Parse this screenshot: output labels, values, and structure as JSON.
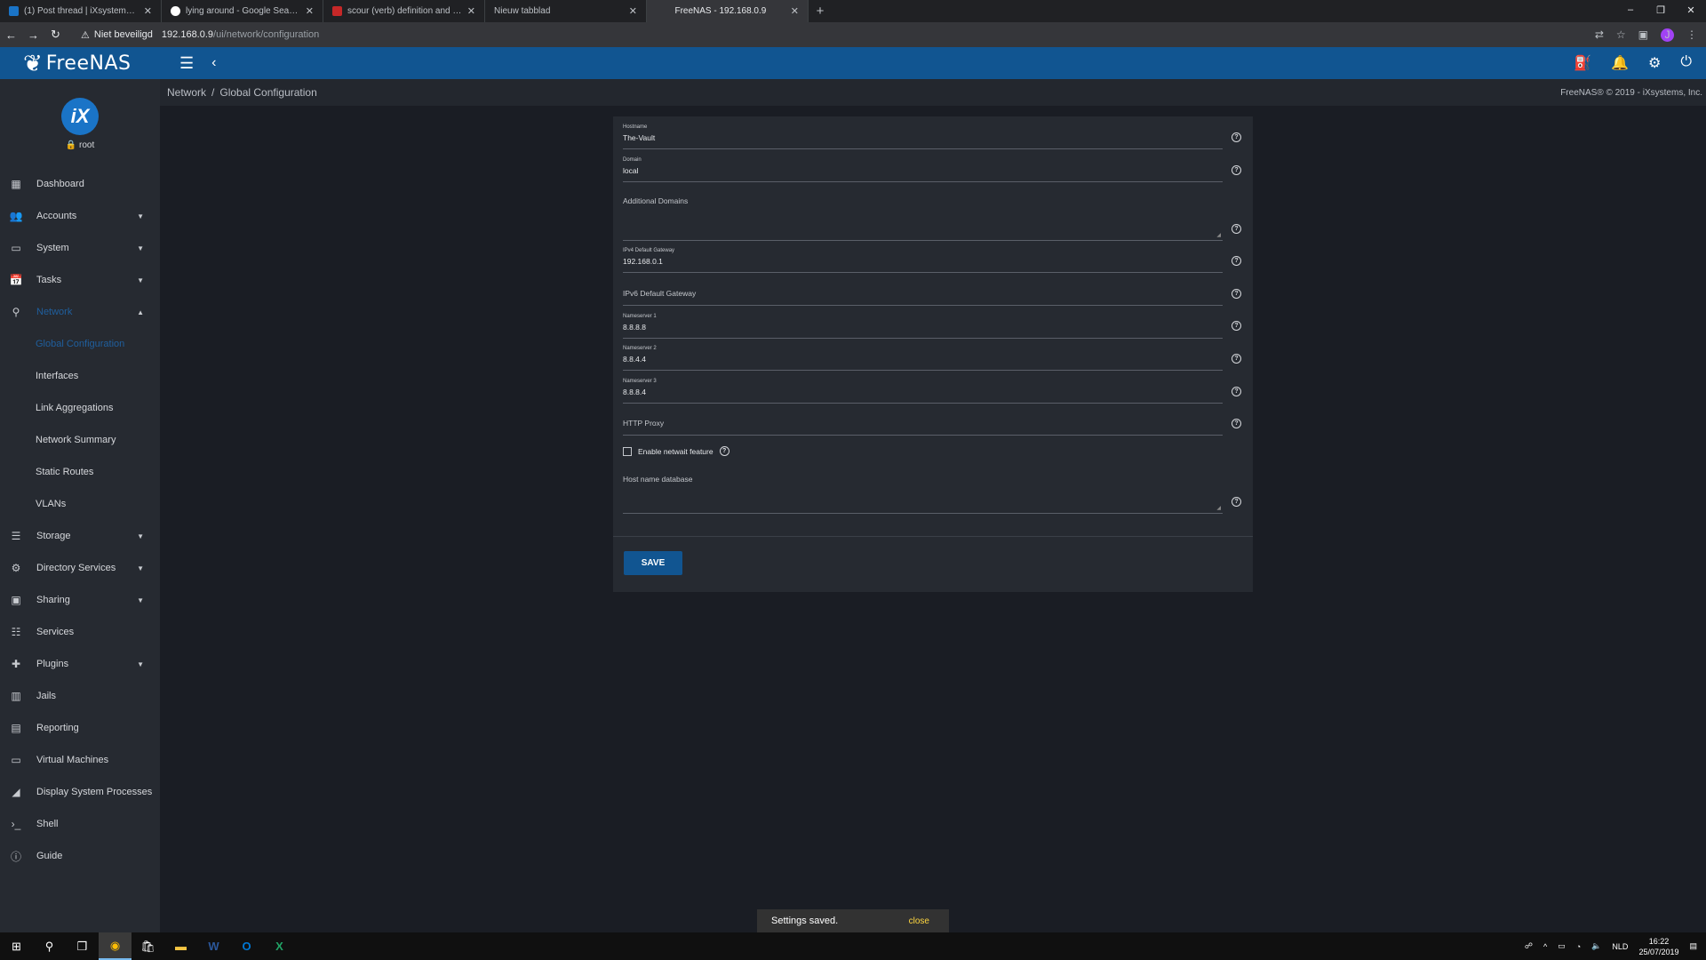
{
  "browser": {
    "tabs": [
      {
        "title": "(1) Post thread | iXsystems Comm",
        "color": "#1a74c7",
        "active": false
      },
      {
        "title": "lying around - Google Search",
        "color": "#ffffff",
        "active": false
      },
      {
        "title": "scour (verb) definition and synonyms",
        "color": "#c62828",
        "active": false
      },
      {
        "title": "Nieuw tabblad",
        "color": "",
        "active": false
      },
      {
        "title": "FreeNAS - 192.168.0.9",
        "color": "",
        "active": true
      }
    ],
    "not_secure_label": "Niet beveiligd",
    "url_host": "192.168.0.9",
    "url_path": "/ui/network/configuration"
  },
  "app": {
    "logo_text": "FreeNAS",
    "breadcrumb": [
      "Network",
      "Global Configuration"
    ],
    "copyright": "FreeNAS® © 2019 - iXsystems, Inc."
  },
  "sidebar": {
    "logo_text": "iX",
    "user": "root",
    "items": [
      {
        "label": "Dashboard",
        "icon": "▦",
        "caret": false
      },
      {
        "label": "Accounts",
        "icon": "👥",
        "caret": true
      },
      {
        "label": "System",
        "icon": "▭",
        "caret": true
      },
      {
        "label": "Tasks",
        "icon": "📅",
        "caret": true
      },
      {
        "label": "Network",
        "icon": "⚲",
        "caret": true,
        "active": true
      }
    ],
    "network_sub": [
      {
        "label": "Global Configuration",
        "active": true
      },
      {
        "label": "Interfaces"
      },
      {
        "label": "Link Aggregations"
      },
      {
        "label": "Network Summary"
      },
      {
        "label": "Static Routes"
      },
      {
        "label": "VLANs"
      }
    ],
    "items_after": [
      {
        "label": "Storage",
        "icon": "☰",
        "caret": true
      },
      {
        "label": "Directory Services",
        "icon": "⚙",
        "caret": true
      },
      {
        "label": "Sharing",
        "icon": "▣",
        "caret": true
      },
      {
        "label": "Services",
        "icon": "☷",
        "caret": false
      },
      {
        "label": "Plugins",
        "icon": "✚",
        "caret": true
      },
      {
        "label": "Jails",
        "icon": "▥",
        "caret": false
      },
      {
        "label": "Reporting",
        "icon": "▤",
        "caret": false
      },
      {
        "label": "Virtual Machines",
        "icon": "▭",
        "caret": false
      },
      {
        "label": "Display System Processes",
        "icon": "◢",
        "caret": false
      },
      {
        "label": "Shell",
        "icon": "›_",
        "caret": false
      },
      {
        "label": "Guide",
        "icon": "ⓘ",
        "caret": false
      }
    ]
  },
  "form": {
    "hostname": {
      "label": "Hostname",
      "value": "The-Vault"
    },
    "domain": {
      "label": "Domain",
      "value": "local"
    },
    "additional_domains": {
      "placeholder": "Additional Domains"
    },
    "ipv4_gateway": {
      "label": "IPv4 Default Gateway",
      "value": "192.168.0.1"
    },
    "ipv6_gateway": {
      "placeholder": "IPv6 Default Gateway"
    },
    "nameserver1": {
      "label": "Nameserver 1",
      "value": "8.8.8.8"
    },
    "nameserver2": {
      "label": "Nameserver 2",
      "value": "8.8.4.4"
    },
    "nameserver3": {
      "label": "Nameserver 3",
      "value": "8.8.8.4"
    },
    "http_proxy": {
      "placeholder": "HTTP Proxy"
    },
    "netwait": {
      "label": "Enable netwait feature",
      "checked": false
    },
    "hosts_db": {
      "placeholder": "Host name database"
    },
    "save_label": "SAVE"
  },
  "snackbar": {
    "message": "Settings saved.",
    "action": "close"
  },
  "taskbar": {
    "lang": "NLD",
    "time": "16:22",
    "date": "25/07/2019"
  }
}
